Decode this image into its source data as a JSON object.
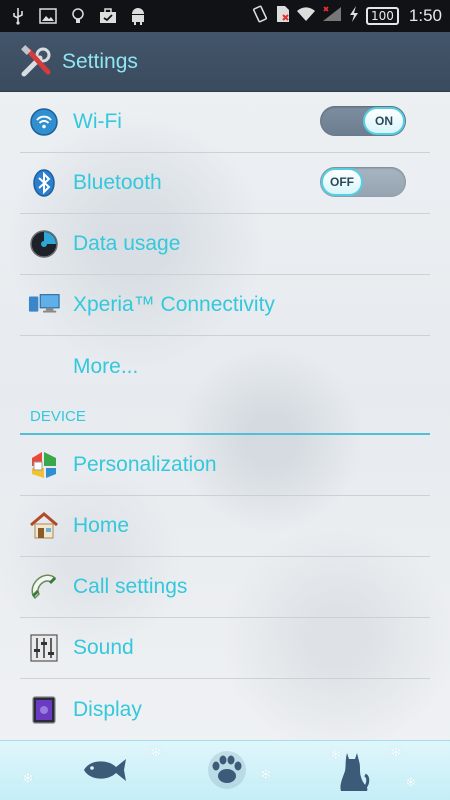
{
  "status_bar": {
    "battery": "100",
    "time": "1:50",
    "left_icons": [
      "usb-icon",
      "image-icon",
      "lightbulb-icon",
      "briefcase-icon",
      "android-icon"
    ],
    "right_icons": [
      "vibrate-icon",
      "sim-icon",
      "wifi-icon",
      "signal-icon",
      "charging-icon"
    ]
  },
  "action_bar": {
    "title": "Settings",
    "icon": "settings-tools-icon",
    "title_color": "#8fe6f2",
    "background": "#3e5064"
  },
  "wireless": {
    "items": [
      {
        "label": "Wi-Fi",
        "icon": "wifi-icon",
        "toggle": "ON"
      },
      {
        "label": "Bluetooth",
        "icon": "bluetooth-icon",
        "toggle": "OFF"
      },
      {
        "label": "Data usage",
        "icon": "data-usage-icon"
      },
      {
        "label": "Xperia™ Connectivity",
        "icon": "connectivity-icon"
      },
      {
        "label": "More..."
      }
    ]
  },
  "device": {
    "header": "DEVICE",
    "items": [
      {
        "label": "Personalization",
        "icon": "personalization-icon"
      },
      {
        "label": "Home",
        "icon": "home-icon"
      },
      {
        "label": "Call settings",
        "icon": "phone-icon"
      },
      {
        "label": "Sound",
        "icon": "equalizer-icon"
      },
      {
        "label": "Display",
        "icon": "display-icon"
      }
    ]
  },
  "dock": {
    "items": [
      "fish-icon",
      "paw-icon",
      "cat-icon"
    ]
  },
  "colors": {
    "accent": "#33c8dc",
    "divider_accent": "#52bfd6",
    "dock_bg": "#d2f1f8"
  }
}
